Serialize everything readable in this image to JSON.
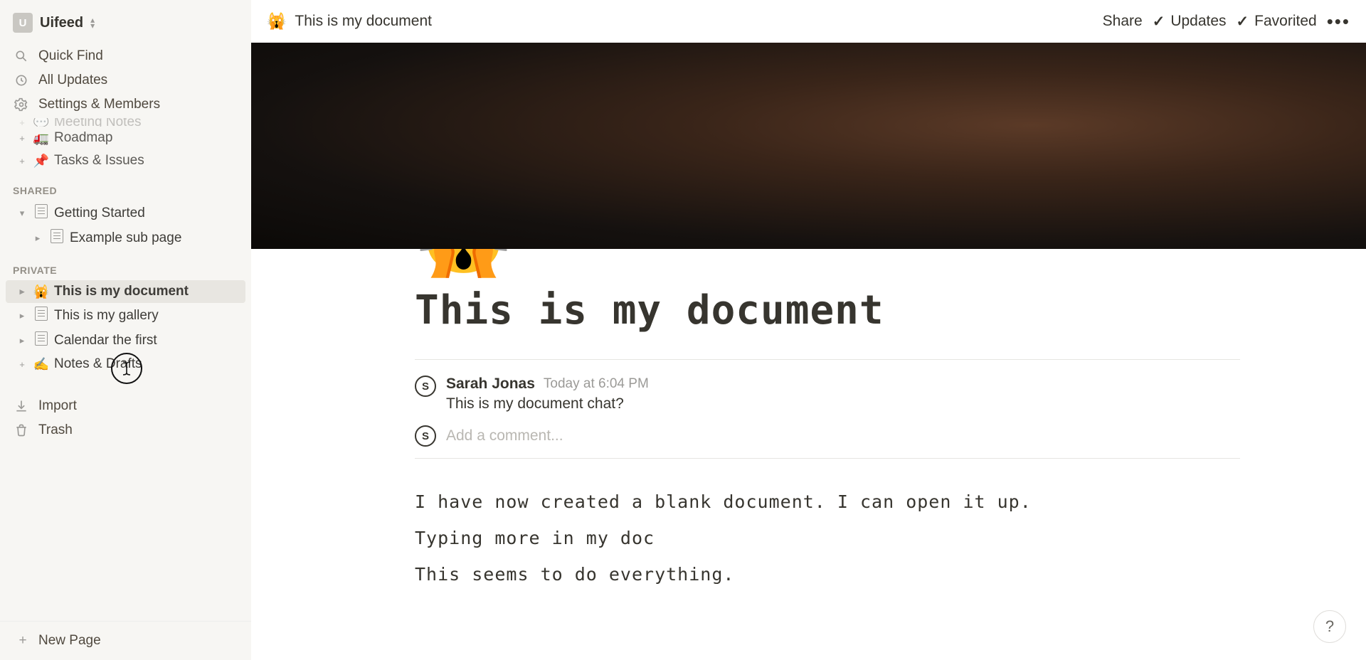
{
  "workspace": {
    "name": "Uifeed",
    "avatar_initial": "U"
  },
  "sidebar": {
    "nav": {
      "quick_find": "Quick Find",
      "all_updates": "All Updates",
      "settings": "Settings & Members"
    },
    "truncated_items": [
      {
        "icon": "💬",
        "label": "Meeting Notes",
        "prefix": "plus"
      },
      {
        "icon": "🚛",
        "label": "Roadmap",
        "prefix": "plus"
      },
      {
        "icon": "📌",
        "label": "Tasks & Issues",
        "prefix": "plus"
      }
    ],
    "sections": {
      "shared": {
        "title": "Shared",
        "items": [
          {
            "icon": "page",
            "label": "Getting Started",
            "chevron": "down",
            "children": [
              {
                "icon": "page",
                "label": "Example sub page",
                "chevron": "right"
              }
            ]
          }
        ]
      },
      "private": {
        "title": "Private",
        "items": [
          {
            "icon": "🙀",
            "label": "This is my document",
            "chevron": "right",
            "active": true
          },
          {
            "icon": "page",
            "label": "This is my gallery",
            "chevron": "right"
          },
          {
            "icon": "page",
            "label": "Calendar the first",
            "chevron": "right"
          },
          {
            "icon": "✍️",
            "label": "Notes & Drafts",
            "chevron": "plus"
          }
        ]
      }
    },
    "footer": {
      "import": "Import",
      "trash": "Trash",
      "new_page": "New Page"
    }
  },
  "topbar": {
    "breadcrumb_icon": "🙀",
    "breadcrumb_title": "This is my document",
    "share": "Share",
    "updates": "Updates",
    "favorited": "Favorited"
  },
  "page": {
    "emoji": "🙀",
    "title": "This is my document",
    "comment": {
      "avatar_initial": "S",
      "author": "Sarah Jonas",
      "timestamp": "Today at 6:04 PM",
      "text": "This is my document chat?",
      "input_placeholder": "Add a comment..."
    },
    "body": [
      "I have now created a blank document. I can open it up.",
      "Typing more in my doc",
      "This seems to do everything."
    ]
  },
  "help_label": "?"
}
